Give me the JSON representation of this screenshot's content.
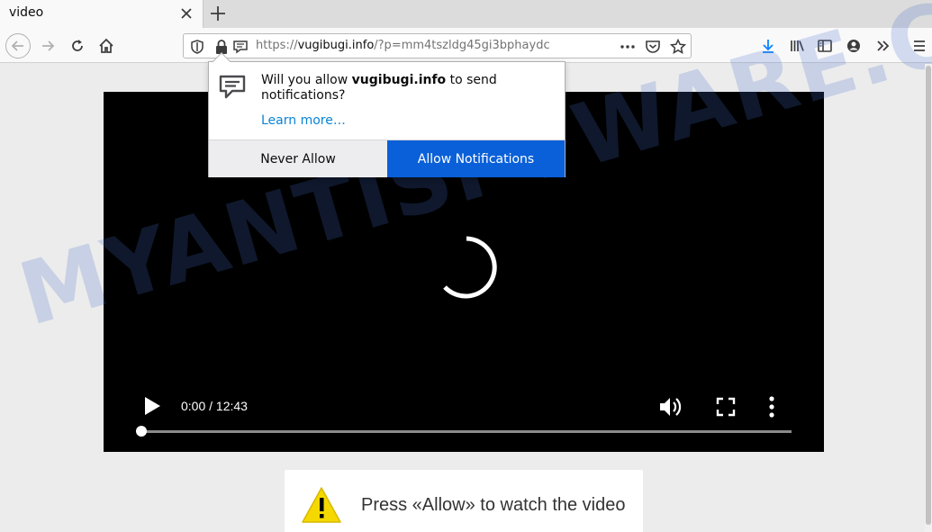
{
  "tab": {
    "title": "video"
  },
  "url": {
    "prefix": "https://",
    "host": "vugibugi.info",
    "path": "/?p=mm4tszldg45gi3bphaydc"
  },
  "popup": {
    "msg_before": "Will you allow ",
    "msg_host": "vugibugi.info",
    "msg_after": " to send notifications?",
    "learn_more": "Learn more…",
    "never_label": "Never Allow",
    "allow_label": "Allow Notifications"
  },
  "video": {
    "time": "0:00 / 12:43",
    "progress": 0.0
  },
  "notice": {
    "text": "Press «Allow» to watch the video"
  },
  "watermark": {
    "text": "MYANTISPYWARE.COM"
  },
  "colors": {
    "allow_button": "#0a60d8",
    "link": "#0a84d6",
    "warning": "#f5d800"
  },
  "icons": [
    "close-icon",
    "plus-icon",
    "back-arrow-icon",
    "forward-arrow-icon",
    "reload-icon",
    "home-icon",
    "shield-icon",
    "lock-icon",
    "notification-icon",
    "more-icon",
    "pocket-icon",
    "star-icon",
    "download-icon",
    "library-icon",
    "sidebar-icon",
    "account-icon",
    "overflow-icon",
    "menu-icon",
    "play-icon",
    "volume-icon",
    "fullscreen-icon",
    "kebab-icon",
    "warning-icon",
    "spinner-icon"
  ]
}
